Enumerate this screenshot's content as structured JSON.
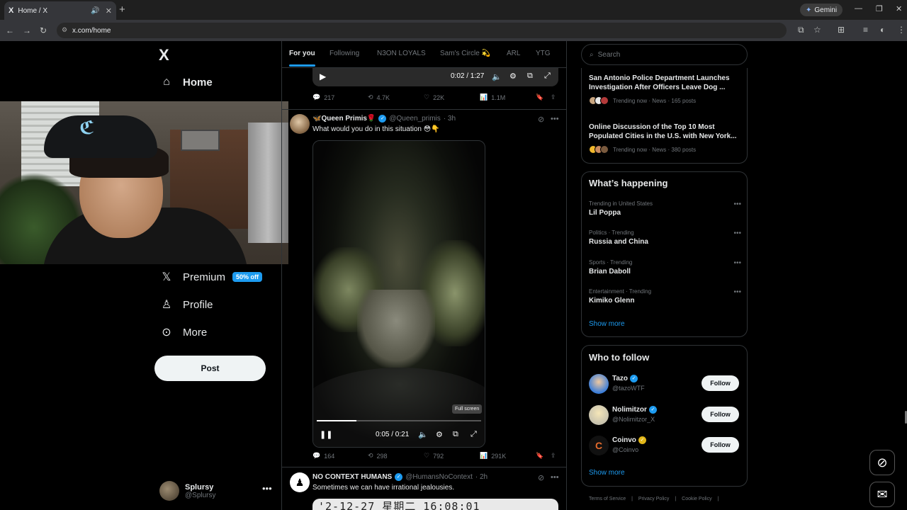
{
  "browser": {
    "tab_title": "Home / X",
    "url": "x.com/home",
    "gemini_label": "Gemini",
    "favicon": "X"
  },
  "sidebar": {
    "logo": "X",
    "items": [
      {
        "label": "Home",
        "icon": "home-icon"
      },
      {
        "label": "Premium",
        "icon": "x-icon",
        "badge": "50% off"
      },
      {
        "label": "Profile",
        "icon": "person-icon"
      },
      {
        "label": "More",
        "icon": "more-circle-icon"
      }
    ],
    "post_label": "Post",
    "account": {
      "name": "Splursy",
      "handle": "@Splursy"
    }
  },
  "feed": {
    "tabs": [
      "For you",
      "Following",
      "N3ON LOYALS",
      "Sam's Circle 💫",
      "ARL",
      "YTG"
    ],
    "prev_video": {
      "time": "0:02 / 1:27"
    },
    "prev_actions": {
      "replies": "217",
      "reposts": "4.7K",
      "likes": "22K",
      "views": "1.1M"
    },
    "tweet1": {
      "name": "🦋Queen Primis🌹",
      "handle": "@Queen_primis",
      "time": "· 3h",
      "text": "What would you do in this situation 😳👇",
      "video_time": "0:05 / 0:21",
      "progress": 0.24,
      "tooltip": "Full screen",
      "actions": {
        "replies": "164",
        "reposts": "298",
        "likes": "792",
        "views": "291K"
      }
    },
    "tweet2": {
      "name": "NO CONTEXT HUMANS",
      "handle": "@HumansNoContext",
      "time": "· 2h",
      "text": "Sometimes we can have irrational jealousies.",
      "media_text": "'2-12-27 星期二 16:08:01"
    }
  },
  "right": {
    "search_placeholder": "Search",
    "news": [
      {
        "title": "San Antonio Police Department Launches Investigation After Officers Leave Dog ...",
        "meta": "Trending now · News · 165 posts"
      },
      {
        "title": "Online Discussion of the Top 10 Most Populated Cities in the U.S. with New York...",
        "meta": "Trending now · News · 380 posts"
      }
    ],
    "happening": {
      "title": "What’s happening",
      "trends": [
        {
          "category": "Trending in United States",
          "name": "Lil Poppa"
        },
        {
          "category": "Politics · Trending",
          "name": "Russia and China"
        },
        {
          "category": "Sports · Trending",
          "name": "Brian Daboll"
        },
        {
          "category": "Entertainment · Trending",
          "name": "Kimiko Glenn"
        }
      ],
      "show_more": "Show more"
    },
    "who_to_follow": {
      "title": "Who to follow",
      "users": [
        {
          "name": "Tazo",
          "handle": "@tazoWTF",
          "follow": "Follow"
        },
        {
          "name": "Nolimitzor",
          "handle": "@Nolimitzor_X",
          "follow": "Follow"
        },
        {
          "name": "Coinvo",
          "handle": "@Coinvo",
          "follow": "Follow"
        }
      ],
      "show_more": "Show more"
    },
    "footer": [
      "Terms of Service",
      "|",
      "Privacy Policy",
      "|",
      "Cookie Policy",
      "|"
    ]
  }
}
